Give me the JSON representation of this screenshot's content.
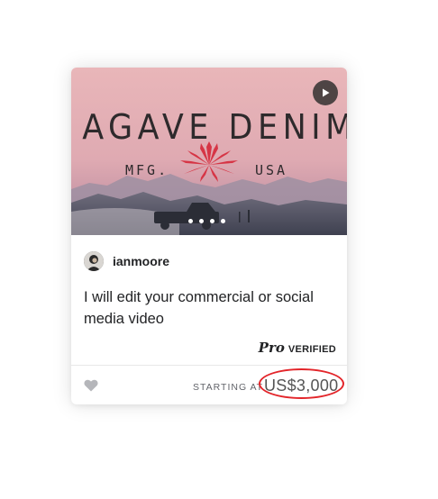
{
  "gig_card": {
    "brand_title": "AGAVE DENIM",
    "brand_left": "MFG.",
    "brand_right": "USA",
    "seller_name": "ianmoore",
    "title": "I will edit your commercial or social media video",
    "pro_mark": "Pro",
    "pro_verified": "VERIFIED",
    "starting_at": "STARTING AT",
    "price": "US$3,000",
    "gallery_dot_count": 4,
    "icons": {
      "play": "play-icon",
      "favorite": "heart-icon",
      "brand_logo": "agave-plant-icon"
    },
    "colors": {
      "sky_top": "#e9b4b8",
      "sky_bottom": "#d7a6b0",
      "agave": "#d63545",
      "annotation_circle": "#e3252a",
      "text_dark": "#222325",
      "text_muted": "#62646a"
    }
  }
}
